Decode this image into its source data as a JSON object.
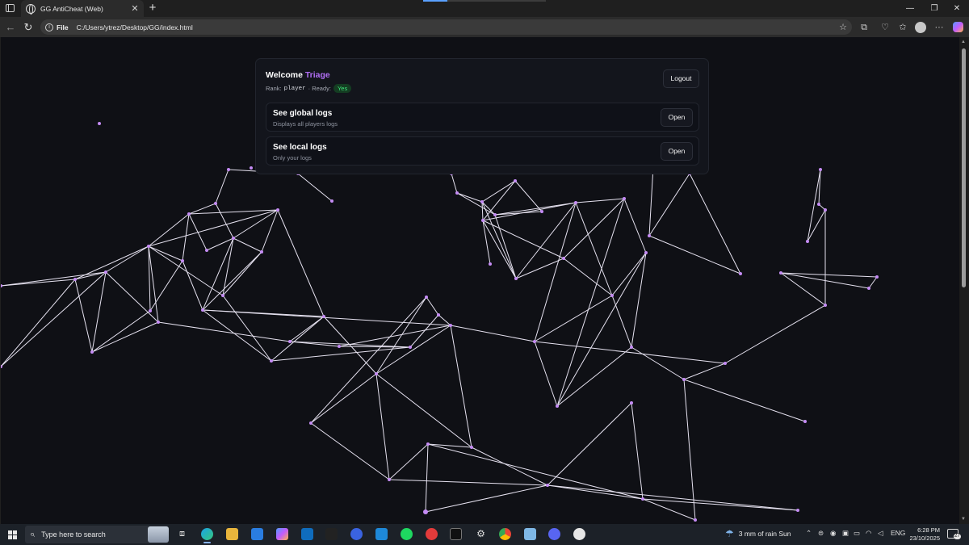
{
  "browser": {
    "tab_title": "GG AntiCheat (Web)",
    "address_scheme": "File",
    "address_url": "C:/Users/ytrez/Desktop/GG/index.html"
  },
  "panel": {
    "welcome_prefix": "Welcome",
    "username": "Triage",
    "rank_label": "Rank:",
    "rank_value": "player",
    "ready_label": "· Ready:",
    "ready_value": "Yes",
    "logout_label": "Logout",
    "cards": [
      {
        "title": "See global logs",
        "subtitle": "Displays all players logs",
        "button": "Open"
      },
      {
        "title": "See local logs",
        "subtitle": "Only your logs",
        "button": "Open"
      }
    ]
  },
  "colors": {
    "accent": "#b16ff5",
    "background": "#0f1015",
    "ready_badge": "#3fe07a",
    "network_line": "#e6e2f0",
    "network_node": "#c58cf5"
  },
  "taskbar": {
    "search_placeholder": "Type here to search",
    "weather": "3 mm of rain Sun",
    "language": "ENG",
    "time": "6:28 PM",
    "date": "23/10/2025",
    "notification_count": "27",
    "apps": [
      "task-view-icon",
      "edge-icon",
      "file-explorer-icon",
      "store-icon",
      "copilot-icon",
      "outlook-icon",
      "app-icon",
      "bluestacks-icon",
      "vscode-icon",
      "spotify-icon",
      "app-red-icon",
      "terminal-icon",
      "settings-icon",
      "chrome-icon",
      "folder-icon",
      "discord-icon",
      "paint-icon"
    ]
  }
}
